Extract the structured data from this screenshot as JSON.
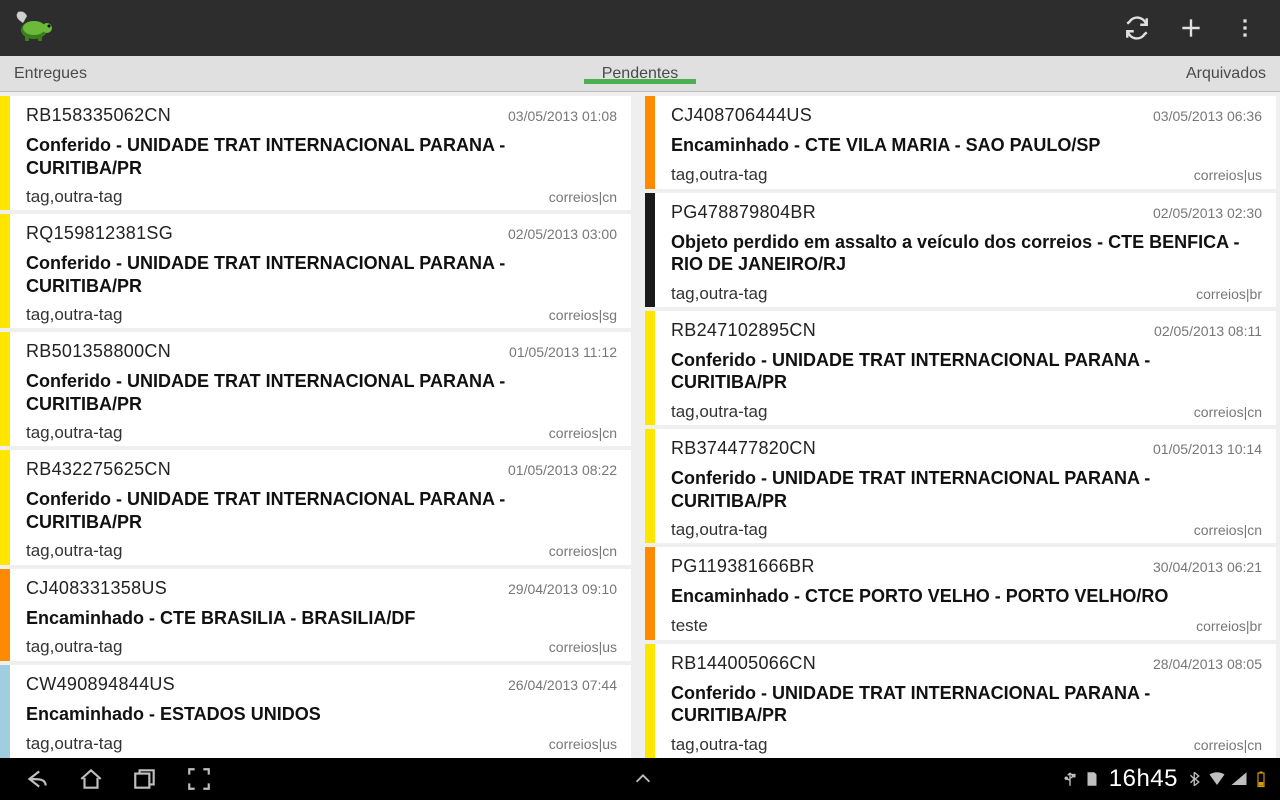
{
  "tabs": {
    "left": "Entregues",
    "center": "Pendentes",
    "right": "Arquivados"
  },
  "statusbar": {
    "time": "16h45"
  },
  "columns": [
    [
      {
        "stripe": "yellow",
        "code": "RB158335062CN",
        "date": "03/05/2013 01:08",
        "status": "Conferido - UNIDADE TRAT INTERNACIONAL PARANA - CURITIBA/PR",
        "tags": "tag,outra-tag",
        "carrier": "correios|cn"
      },
      {
        "stripe": "yellow",
        "code": "RQ159812381SG",
        "date": "02/05/2013 03:00",
        "status": "Conferido - UNIDADE TRAT INTERNACIONAL PARANA - CURITIBA/PR",
        "tags": "tag,outra-tag",
        "carrier": "correios|sg"
      },
      {
        "stripe": "yellow",
        "code": "RB501358800CN",
        "date": "01/05/2013 11:12",
        "status": "Conferido - UNIDADE TRAT INTERNACIONAL PARANA - CURITIBA/PR",
        "tags": "tag,outra-tag",
        "carrier": "correios|cn"
      },
      {
        "stripe": "yellow",
        "code": "RB432275625CN",
        "date": "01/05/2013 08:22",
        "status": "Conferido - UNIDADE TRAT INTERNACIONAL PARANA - CURITIBA/PR",
        "tags": "tag,outra-tag",
        "carrier": "correios|cn"
      },
      {
        "stripe": "orange",
        "code": "CJ408331358US",
        "date": "29/04/2013 09:10",
        "status": "Encaminhado - CTE BRASILIA - BRASILIA/DF",
        "tags": "tag,outra-tag",
        "carrier": "correios|us"
      },
      {
        "stripe": "lightblue",
        "code": "CW490894844US",
        "date": "26/04/2013 07:44",
        "status": "Encaminhado - ESTADOS UNIDOS",
        "tags": "tag,outra-tag",
        "carrier": "correios|us"
      }
    ],
    [
      {
        "stripe": "orange",
        "code": "CJ408706444US",
        "date": "03/05/2013 06:36",
        "status": "Encaminhado - CTE VILA MARIA - SAO PAULO/SP",
        "tags": "tag,outra-tag",
        "carrier": "correios|us"
      },
      {
        "stripe": "black",
        "code": "PG478879804BR",
        "date": "02/05/2013 02:30",
        "status": "Objeto perdido em assalto a veículo dos correios - CTE BENFICA - RIO DE JANEIRO/RJ",
        "tags": "tag,outra-tag",
        "carrier": "correios|br"
      },
      {
        "stripe": "yellow",
        "code": "RB247102895CN",
        "date": "02/05/2013 08:11",
        "status": "Conferido - UNIDADE TRAT INTERNACIONAL PARANA - CURITIBA/PR",
        "tags": "tag,outra-tag",
        "carrier": "correios|cn"
      },
      {
        "stripe": "yellow",
        "code": "RB374477820CN",
        "date": "01/05/2013 10:14",
        "status": "Conferido - UNIDADE TRAT INTERNACIONAL PARANA - CURITIBA/PR",
        "tags": "tag,outra-tag",
        "carrier": "correios|cn"
      },
      {
        "stripe": "orange",
        "code": "PG119381666BR",
        "date": "30/04/2013 06:21",
        "status": "Encaminhado - CTCE PORTO VELHO - PORTO VELHO/RO",
        "tags": "teste",
        "carrier": "correios|br"
      },
      {
        "stripe": "yellow",
        "code": "RB144005066CN",
        "date": "28/04/2013 08:05",
        "status": "Conferido - UNIDADE TRAT INTERNACIONAL PARANA - CURITIBA/PR",
        "tags": "tag,outra-tag",
        "carrier": "correios|cn"
      }
    ]
  ]
}
